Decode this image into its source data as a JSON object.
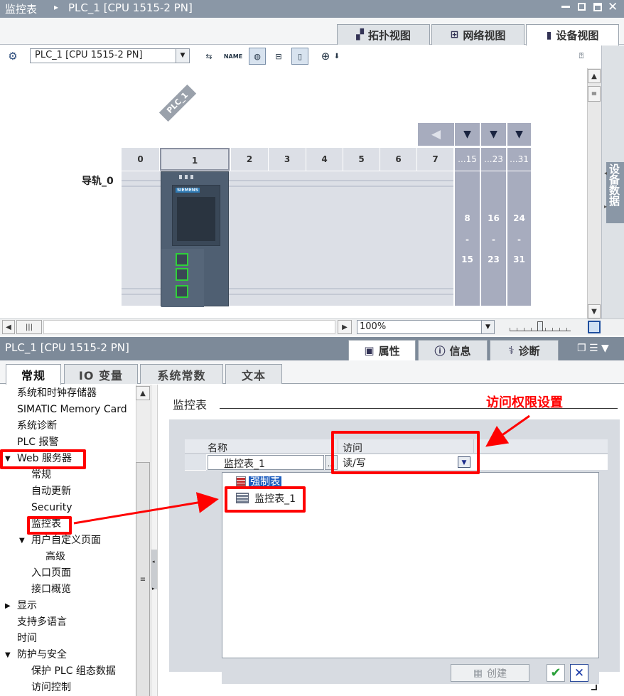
{
  "editor": {
    "title_root": "监控表",
    "title_sep": "▸",
    "title_device": "PLC_1 [CPU 1515-2 PN]",
    "view_tabs": [
      {
        "label": "拓扑视图",
        "icon": "topology-icon",
        "active": false
      },
      {
        "label": "网络视图",
        "icon": "network-icon",
        "active": false
      },
      {
        "label": "设备视图",
        "icon": "device-icon",
        "active": true
      }
    ],
    "device_select": "PLC_1 [CPU 1515-2 PN]",
    "plc_tag": "PLC_1",
    "rail_label": "导轨_0",
    "slots": [
      "0",
      "1",
      "2",
      "3",
      "4",
      "5",
      "6",
      "7"
    ],
    "expand_slots": [
      {
        "head": "...15",
        "top": "8",
        "mid": "-",
        "bottom": "15"
      },
      {
        "head": "...23",
        "top": "16",
        "mid": "-",
        "bottom": "23"
      },
      {
        "head": "...31",
        "top": "24",
        "mid": "-",
        "bottom": "31"
      }
    ],
    "side_panel_label": "设备数据",
    "zoom": "100%",
    "brand": "SIEMENS"
  },
  "inspector": {
    "title": "PLC_1 [CPU 1515-2 PN]",
    "tabs": [
      {
        "label": "属性",
        "active": true
      },
      {
        "label": "信息",
        "active": false
      },
      {
        "label": "诊断",
        "active": false
      }
    ],
    "sub_tabs": [
      {
        "label": "常规",
        "active": true
      },
      {
        "label": "IO 变量",
        "active": false
      },
      {
        "label": "系统常数",
        "active": false
      },
      {
        "label": "文本",
        "active": false
      }
    ],
    "nav": [
      {
        "label": "系统和时钟存储器",
        "indent": 0,
        "arrow": ""
      },
      {
        "label": "SIMATIC Memory Card",
        "indent": 0,
        "arrow": ""
      },
      {
        "label": "系统诊断",
        "indent": 0,
        "arrow": ""
      },
      {
        "label": "PLC 报警",
        "indent": 0,
        "arrow": ""
      },
      {
        "label": "Web 服务器",
        "indent": 0,
        "arrow": "▼"
      },
      {
        "label": "常规",
        "indent": 1,
        "arrow": ""
      },
      {
        "label": "自动更新",
        "indent": 1,
        "arrow": ""
      },
      {
        "label": "Security",
        "indent": 1,
        "arrow": ""
      },
      {
        "label": "监控表",
        "indent": 1,
        "arrow": ""
      },
      {
        "label": "用户自定义页面",
        "indent": 1,
        "arrow": "▼"
      },
      {
        "label": "高级",
        "indent": 2,
        "arrow": ""
      },
      {
        "label": "入口页面",
        "indent": 1,
        "arrow": ""
      },
      {
        "label": "接口概览",
        "indent": 1,
        "arrow": ""
      },
      {
        "label": "显示",
        "indent": 0,
        "arrow": "▶"
      },
      {
        "label": "支持多语言",
        "indent": 0,
        "arrow": ""
      },
      {
        "label": "时间",
        "indent": 0,
        "arrow": ""
      },
      {
        "label": "防护与安全",
        "indent": 0,
        "arrow": "▼"
      },
      {
        "label": "保护 PLC 组态数据",
        "indent": 1,
        "arrow": ""
      },
      {
        "label": "访问控制",
        "indent": 1,
        "arrow": ""
      }
    ],
    "section_title": "监控表",
    "columns": {
      "name": "名称",
      "access": "访问"
    },
    "row": {
      "name": "监控表_1",
      "browse": "...",
      "access": "读/写"
    },
    "dropdown_items": [
      {
        "label": "强制表",
        "icon": "force-table-icon",
        "selected": true
      },
      {
        "label": "监控表_1",
        "icon": "watch-table-icon",
        "selected": false
      }
    ],
    "create_label": "创建",
    "annotation": "访问权限设置",
    "colors": {
      "annotation_red": "#ff0000",
      "title_bar": "#8a97a6",
      "selected_blue": "#1f5fbf"
    }
  }
}
